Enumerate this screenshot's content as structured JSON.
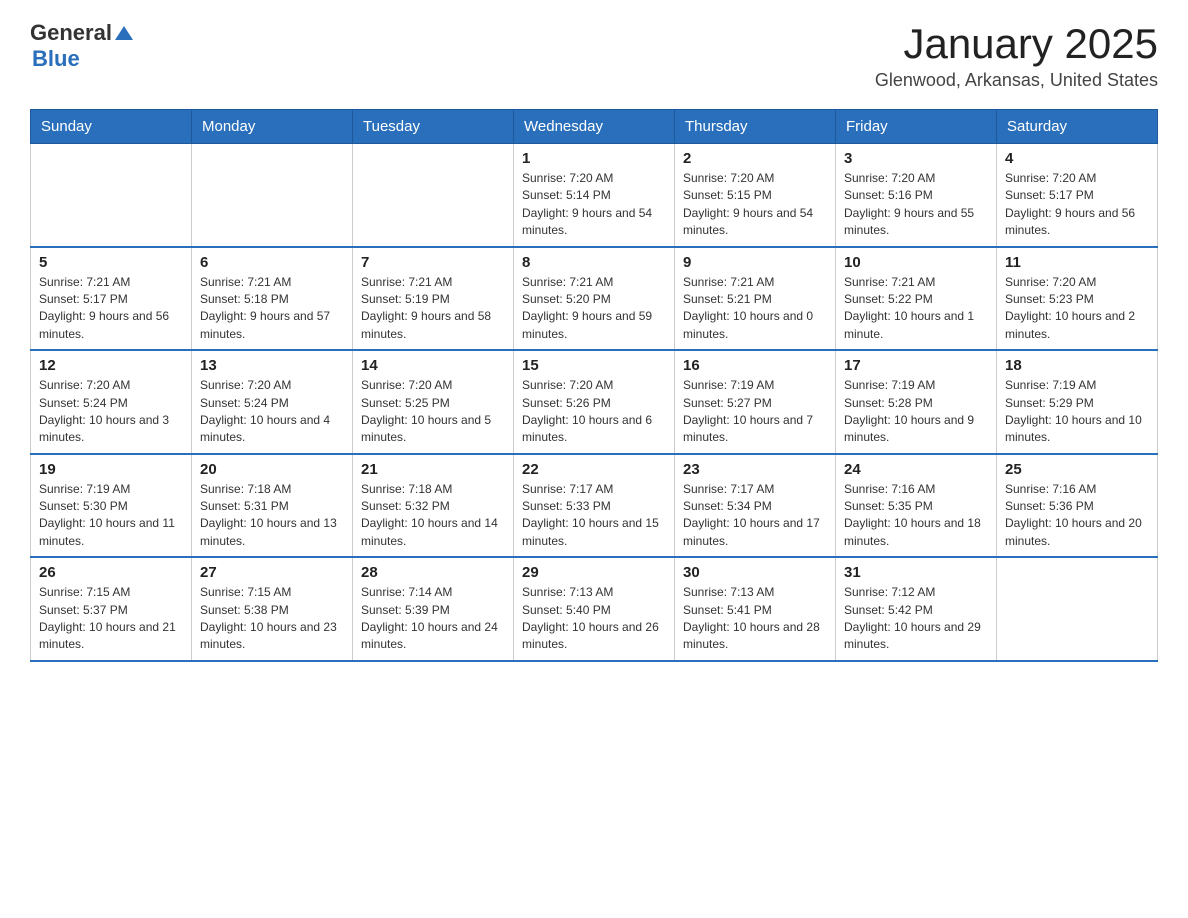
{
  "header": {
    "logo_general": "General",
    "logo_blue": "Blue",
    "title": "January 2025",
    "subtitle": "Glenwood, Arkansas, United States"
  },
  "days_of_week": [
    "Sunday",
    "Monday",
    "Tuesday",
    "Wednesday",
    "Thursday",
    "Friday",
    "Saturday"
  ],
  "weeks": [
    [
      {
        "day": "",
        "info": ""
      },
      {
        "day": "",
        "info": ""
      },
      {
        "day": "",
        "info": ""
      },
      {
        "day": "1",
        "info": "Sunrise: 7:20 AM\nSunset: 5:14 PM\nDaylight: 9 hours and 54 minutes."
      },
      {
        "day": "2",
        "info": "Sunrise: 7:20 AM\nSunset: 5:15 PM\nDaylight: 9 hours and 54 minutes."
      },
      {
        "day": "3",
        "info": "Sunrise: 7:20 AM\nSunset: 5:16 PM\nDaylight: 9 hours and 55 minutes."
      },
      {
        "day": "4",
        "info": "Sunrise: 7:20 AM\nSunset: 5:17 PM\nDaylight: 9 hours and 56 minutes."
      }
    ],
    [
      {
        "day": "5",
        "info": "Sunrise: 7:21 AM\nSunset: 5:17 PM\nDaylight: 9 hours and 56 minutes."
      },
      {
        "day": "6",
        "info": "Sunrise: 7:21 AM\nSunset: 5:18 PM\nDaylight: 9 hours and 57 minutes."
      },
      {
        "day": "7",
        "info": "Sunrise: 7:21 AM\nSunset: 5:19 PM\nDaylight: 9 hours and 58 minutes."
      },
      {
        "day": "8",
        "info": "Sunrise: 7:21 AM\nSunset: 5:20 PM\nDaylight: 9 hours and 59 minutes."
      },
      {
        "day": "9",
        "info": "Sunrise: 7:21 AM\nSunset: 5:21 PM\nDaylight: 10 hours and 0 minutes."
      },
      {
        "day": "10",
        "info": "Sunrise: 7:21 AM\nSunset: 5:22 PM\nDaylight: 10 hours and 1 minute."
      },
      {
        "day": "11",
        "info": "Sunrise: 7:20 AM\nSunset: 5:23 PM\nDaylight: 10 hours and 2 minutes."
      }
    ],
    [
      {
        "day": "12",
        "info": "Sunrise: 7:20 AM\nSunset: 5:24 PM\nDaylight: 10 hours and 3 minutes."
      },
      {
        "day": "13",
        "info": "Sunrise: 7:20 AM\nSunset: 5:24 PM\nDaylight: 10 hours and 4 minutes."
      },
      {
        "day": "14",
        "info": "Sunrise: 7:20 AM\nSunset: 5:25 PM\nDaylight: 10 hours and 5 minutes."
      },
      {
        "day": "15",
        "info": "Sunrise: 7:20 AM\nSunset: 5:26 PM\nDaylight: 10 hours and 6 minutes."
      },
      {
        "day": "16",
        "info": "Sunrise: 7:19 AM\nSunset: 5:27 PM\nDaylight: 10 hours and 7 minutes."
      },
      {
        "day": "17",
        "info": "Sunrise: 7:19 AM\nSunset: 5:28 PM\nDaylight: 10 hours and 9 minutes."
      },
      {
        "day": "18",
        "info": "Sunrise: 7:19 AM\nSunset: 5:29 PM\nDaylight: 10 hours and 10 minutes."
      }
    ],
    [
      {
        "day": "19",
        "info": "Sunrise: 7:19 AM\nSunset: 5:30 PM\nDaylight: 10 hours and 11 minutes."
      },
      {
        "day": "20",
        "info": "Sunrise: 7:18 AM\nSunset: 5:31 PM\nDaylight: 10 hours and 13 minutes."
      },
      {
        "day": "21",
        "info": "Sunrise: 7:18 AM\nSunset: 5:32 PM\nDaylight: 10 hours and 14 minutes."
      },
      {
        "day": "22",
        "info": "Sunrise: 7:17 AM\nSunset: 5:33 PM\nDaylight: 10 hours and 15 minutes."
      },
      {
        "day": "23",
        "info": "Sunrise: 7:17 AM\nSunset: 5:34 PM\nDaylight: 10 hours and 17 minutes."
      },
      {
        "day": "24",
        "info": "Sunrise: 7:16 AM\nSunset: 5:35 PM\nDaylight: 10 hours and 18 minutes."
      },
      {
        "day": "25",
        "info": "Sunrise: 7:16 AM\nSunset: 5:36 PM\nDaylight: 10 hours and 20 minutes."
      }
    ],
    [
      {
        "day": "26",
        "info": "Sunrise: 7:15 AM\nSunset: 5:37 PM\nDaylight: 10 hours and 21 minutes."
      },
      {
        "day": "27",
        "info": "Sunrise: 7:15 AM\nSunset: 5:38 PM\nDaylight: 10 hours and 23 minutes."
      },
      {
        "day": "28",
        "info": "Sunrise: 7:14 AM\nSunset: 5:39 PM\nDaylight: 10 hours and 24 minutes."
      },
      {
        "day": "29",
        "info": "Sunrise: 7:13 AM\nSunset: 5:40 PM\nDaylight: 10 hours and 26 minutes."
      },
      {
        "day": "30",
        "info": "Sunrise: 7:13 AM\nSunset: 5:41 PM\nDaylight: 10 hours and 28 minutes."
      },
      {
        "day": "31",
        "info": "Sunrise: 7:12 AM\nSunset: 5:42 PM\nDaylight: 10 hours and 29 minutes."
      },
      {
        "day": "",
        "info": ""
      }
    ]
  ]
}
